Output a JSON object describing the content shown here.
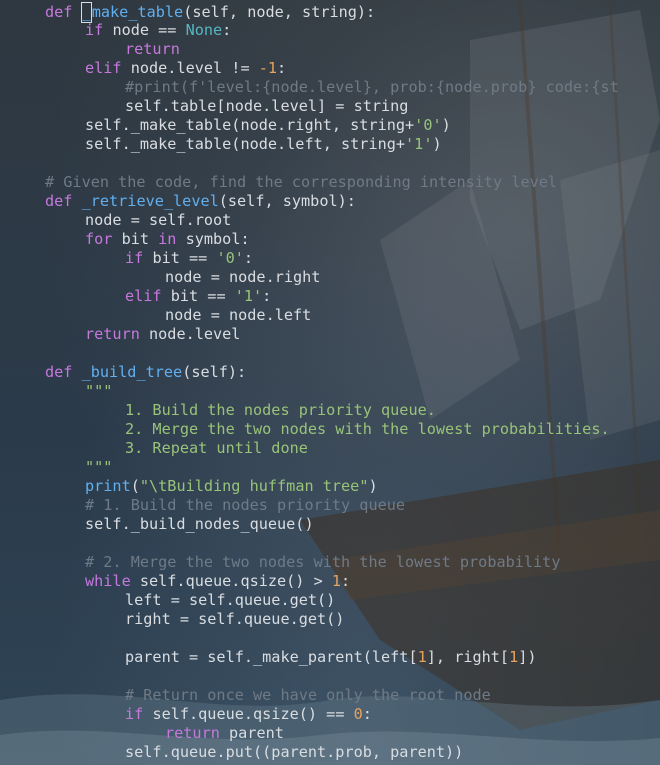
{
  "editor": {
    "lines": [
      {
        "indent": 1,
        "tokens": [
          {
            "t": "def",
            "c": "kw"
          },
          {
            "t": " "
          },
          {
            "t": "_",
            "c": "fn",
            "cursor": true
          },
          {
            "t": "make_table",
            "c": "fn"
          },
          {
            "t": "(self, node, string):"
          }
        ]
      },
      {
        "indent": 2,
        "tokens": [
          {
            "t": "if",
            "c": "kw"
          },
          {
            "t": " node == "
          },
          {
            "t": "None",
            "c": "const"
          },
          {
            "t": ":"
          }
        ]
      },
      {
        "indent": 3,
        "tokens": [
          {
            "t": "return",
            "c": "kw"
          }
        ]
      },
      {
        "indent": 2,
        "tokens": [
          {
            "t": "elif",
            "c": "kw"
          },
          {
            "t": " node.level != "
          },
          {
            "t": "-1",
            "c": "num"
          },
          {
            "t": ":"
          }
        ]
      },
      {
        "indent": 3,
        "tokens": [
          {
            "t": "#print(f'level:{node.level}, prob:{node.prob} code:{st",
            "c": "cm"
          }
        ]
      },
      {
        "indent": 3,
        "tokens": [
          {
            "t": "self.table[node.level] = string"
          }
        ]
      },
      {
        "indent": 2,
        "tokens": [
          {
            "t": "self._make_table(node.right, string+"
          },
          {
            "t": "'0'",
            "c": "str"
          },
          {
            "t": ")"
          }
        ]
      },
      {
        "indent": 2,
        "tokens": [
          {
            "t": "self._make_table(node.left, string+"
          },
          {
            "t": "'1'",
            "c": "str"
          },
          {
            "t": ")"
          }
        ]
      },
      {
        "indent": 0,
        "tokens": []
      },
      {
        "indent": 1,
        "tokens": [
          {
            "t": "# Given the code, find the corresponding intensity level",
            "c": "cm"
          }
        ]
      },
      {
        "indent": 1,
        "tokens": [
          {
            "t": "def",
            "c": "kw"
          },
          {
            "t": " "
          },
          {
            "t": "_retrieve_level",
            "c": "fn"
          },
          {
            "t": "(self, symbol):"
          }
        ]
      },
      {
        "indent": 2,
        "tokens": [
          {
            "t": "node = self.root"
          }
        ]
      },
      {
        "indent": 2,
        "tokens": [
          {
            "t": "for",
            "c": "kw"
          },
          {
            "t": " bit "
          },
          {
            "t": "in",
            "c": "kw"
          },
          {
            "t": " symbol:"
          }
        ]
      },
      {
        "indent": 3,
        "tokens": [
          {
            "t": "if",
            "c": "kw"
          },
          {
            "t": " bit == "
          },
          {
            "t": "'0'",
            "c": "str"
          },
          {
            "t": ":"
          }
        ]
      },
      {
        "indent": 4,
        "tokens": [
          {
            "t": "node = node.right"
          }
        ]
      },
      {
        "indent": 3,
        "tokens": [
          {
            "t": "elif",
            "c": "kw"
          },
          {
            "t": " bit == "
          },
          {
            "t": "'1'",
            "c": "str"
          },
          {
            "t": ":"
          }
        ]
      },
      {
        "indent": 4,
        "tokens": [
          {
            "t": "node = node.left"
          }
        ]
      },
      {
        "indent": 2,
        "tokens": [
          {
            "t": "return",
            "c": "kw"
          },
          {
            "t": " node.level"
          }
        ]
      },
      {
        "indent": 0,
        "tokens": []
      },
      {
        "indent": 1,
        "tokens": [
          {
            "t": "def",
            "c": "kw"
          },
          {
            "t": " "
          },
          {
            "t": "_build_tree",
            "c": "fn"
          },
          {
            "t": "(self):"
          }
        ]
      },
      {
        "indent": 2,
        "tokens": [
          {
            "t": "\"\"\"",
            "c": "str"
          }
        ]
      },
      {
        "indent": 3,
        "tokens": [
          {
            "t": "1. Build the nodes priority queue.",
            "c": "str"
          }
        ]
      },
      {
        "indent": 3,
        "tokens": [
          {
            "t": "2. Merge the two nodes with the lowest probabilities.",
            "c": "str"
          }
        ]
      },
      {
        "indent": 3,
        "tokens": [
          {
            "t": "3. Repeat until done",
            "c": "str"
          }
        ]
      },
      {
        "indent": 2,
        "tokens": [
          {
            "t": "\"\"\"",
            "c": "str"
          }
        ]
      },
      {
        "indent": 2,
        "tokens": [
          {
            "t": "print",
            "c": "fn"
          },
          {
            "t": "("
          },
          {
            "t": "\"\\tBuilding huffman tree\"",
            "c": "str"
          },
          {
            "t": ")"
          }
        ]
      },
      {
        "indent": 2,
        "tokens": [
          {
            "t": "# 1. Build the nodes priority queue",
            "c": "cm"
          }
        ]
      },
      {
        "indent": 2,
        "tokens": [
          {
            "t": "self._build_nodes_queue()"
          }
        ]
      },
      {
        "indent": 0,
        "tokens": []
      },
      {
        "indent": 2,
        "tokens": [
          {
            "t": "# 2. Merge the two nodes with the lowest probability",
            "c": "cm"
          }
        ]
      },
      {
        "indent": 2,
        "tokens": [
          {
            "t": "while",
            "c": "kw"
          },
          {
            "t": " self.queue.qsize() > "
          },
          {
            "t": "1",
            "c": "num"
          },
          {
            "t": ":"
          }
        ]
      },
      {
        "indent": 3,
        "tokens": [
          {
            "t": "left = self.queue.get()"
          }
        ]
      },
      {
        "indent": 3,
        "tokens": [
          {
            "t": "right = self.queue.get()"
          }
        ]
      },
      {
        "indent": 0,
        "tokens": []
      },
      {
        "indent": 3,
        "tokens": [
          {
            "t": "parent = self._make_parent(left["
          },
          {
            "t": "1",
            "c": "num"
          },
          {
            "t": "], right["
          },
          {
            "t": "1",
            "c": "num"
          },
          {
            "t": "])"
          }
        ]
      },
      {
        "indent": 0,
        "tokens": []
      },
      {
        "indent": 3,
        "tokens": [
          {
            "t": "# Return once we have only the root node",
            "c": "cm"
          }
        ]
      },
      {
        "indent": 3,
        "tokens": [
          {
            "t": "if",
            "c": "kw"
          },
          {
            "t": " self.queue.qsize() == "
          },
          {
            "t": "0",
            "c": "num"
          },
          {
            "t": ":"
          }
        ]
      },
      {
        "indent": 4,
        "tokens": [
          {
            "t": "return",
            "c": "kw"
          },
          {
            "t": " parent"
          }
        ]
      },
      {
        "indent": 3,
        "tokens": [
          {
            "t": "self.queue.put((parent.prob, parent))"
          }
        ]
      }
    ]
  }
}
